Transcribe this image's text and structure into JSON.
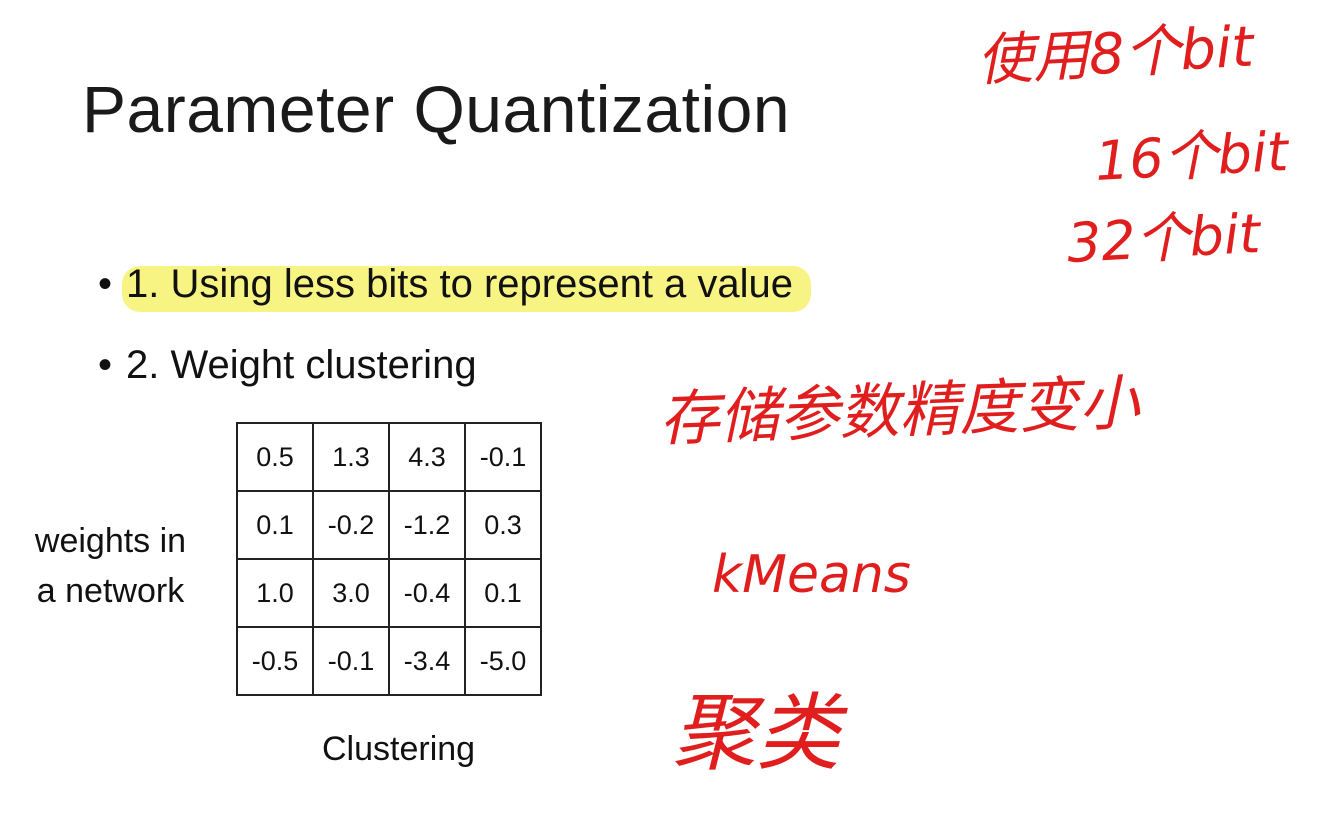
{
  "slide": {
    "title": "Parameter Quantization",
    "bullets": [
      {
        "bullet_char": "•",
        "text": "1. Using less bits to represent a value",
        "highlighted": true
      },
      {
        "bullet_char": "•",
        "text": "2. Weight clustering",
        "highlighted": false
      }
    ],
    "side_label_line1": "weights in",
    "side_label_line2": "a network",
    "weights_table": [
      [
        "0.5",
        "1.3",
        "4.3",
        "-0.1"
      ],
      [
        "0.1",
        "-0.2",
        "-1.2",
        "0.3"
      ],
      [
        "1.0",
        "3.0",
        "-0.4",
        "0.1"
      ],
      [
        "-0.5",
        "-0.1",
        "-3.4",
        "-5.0"
      ]
    ],
    "caption": "Clustering"
  },
  "annotations": {
    "ink_color": "#e01e1e",
    "highlight_color": "#f8f484",
    "bits_line1": "使用8个bit",
    "bits_line2": "16个bit",
    "bits_line3": "32个bit",
    "precision_note": "存储参数精度变小",
    "kmeans": "kMeans",
    "cluster_cn": "聚类"
  }
}
